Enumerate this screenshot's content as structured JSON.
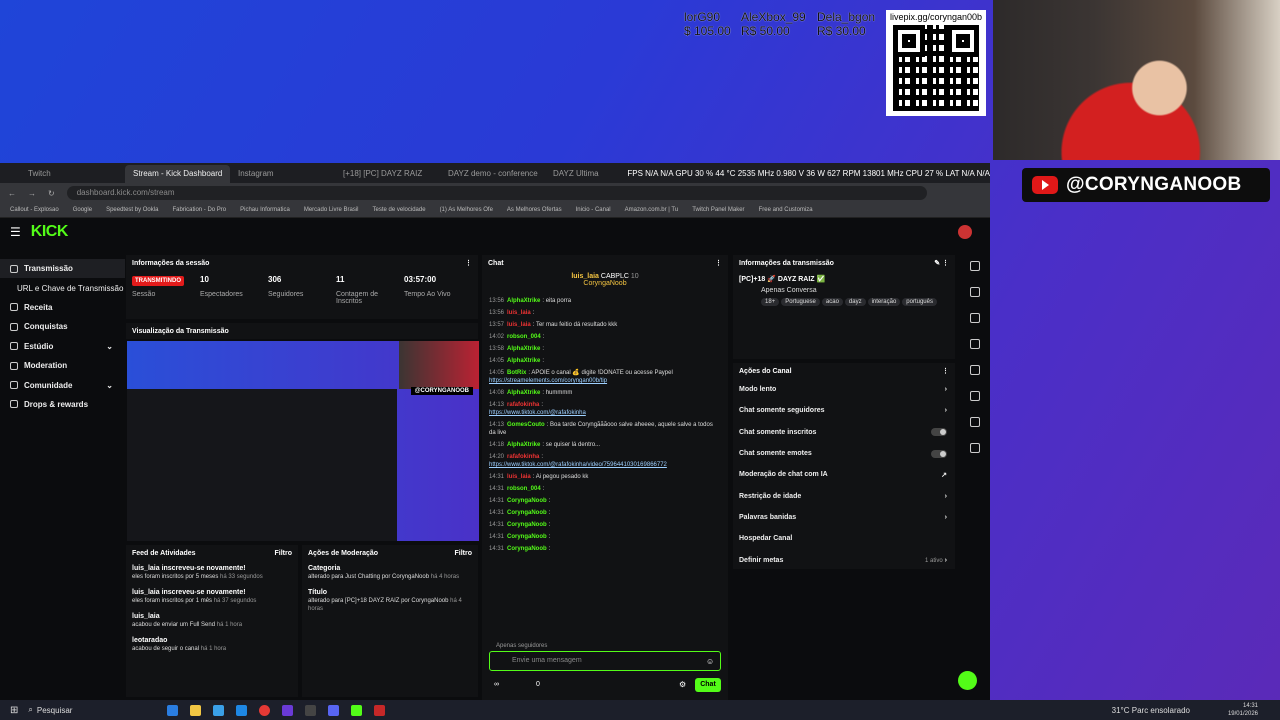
{
  "overlay": {
    "donors": [
      {
        "name": "lorG90",
        "amount": "$ 105.00"
      },
      {
        "name": "AleXbox_99",
        "amount": "R$ 50.00"
      },
      {
        "name": "Dela_bgon",
        "amount": "R$ 30.00"
      }
    ],
    "qr_url": "livepix.gg/coryngan00b",
    "handle": "@CORYNGANOOB"
  },
  "browser": {
    "tabs": [
      "Twitch",
      "Stream - Kick Dashboard",
      "Instagram",
      "[+18] [PC] DAYZ RAIZ",
      "DAYZ demo - conference",
      "DAYZ Ultima"
    ],
    "active_tab": 1,
    "url": "dashboard.kick.com/stream",
    "bookmarks": [
      "Callout - Explosao",
      "Google",
      "Speedtest by Ookla",
      "Fabrication - Do Pro",
      "Pichau Informatica",
      "Mercado Livre Brasil",
      "Teste de velocidade",
      "(1) As Melhores Ofe",
      "As Melhores Ofertas",
      "Inicio - Canal",
      "Amazon.com.br | Tu",
      "Twitch Panel Maker",
      "Free and Customiza"
    ],
    "stats": "FPS N/A  N/A   GPU 30 %  44 °C  2535 MHz  0.980 V  36 W  627 RPM  13801 MHz   CPU 27 %   LAT N/A  N/A"
  },
  "kick": {
    "logo": "KICK",
    "sidebar": [
      {
        "label": "Transmissão",
        "sub": false
      },
      {
        "label": "URL e Chave de Transmissão",
        "sub": true
      },
      {
        "label": "Receita",
        "sub": false
      },
      {
        "label": "Conquistas",
        "sub": false
      },
      {
        "label": "Estúdio",
        "sub": false
      },
      {
        "label": "Moderation",
        "sub": false
      },
      {
        "label": "Comunidade",
        "sub": false
      },
      {
        "label": "Drops & rewards",
        "sub": false
      }
    ],
    "session": {
      "title": "Informações da sessão",
      "status": "TRANSMITINDO",
      "status_label": "Sessão",
      "tiles": [
        {
          "value": "10",
          "label": "Espectadores"
        },
        {
          "value": "306",
          "label": "Seguidores"
        },
        {
          "value": "11",
          "label": "Contagem de Inscritos"
        },
        {
          "value": "03:57:00",
          "label": "Tempo Ao Vivo"
        }
      ]
    },
    "preview_title": "Visualização da Transmissão",
    "feed": {
      "title": "Feed de Atividades",
      "filter": "Filtro",
      "items": [
        {
          "user": "luis_laia inscreveu-se novamente!",
          "detail": "eles foram inscritos por 5 meses",
          "time": "há 33 segundos"
        },
        {
          "user": "luis_laia inscreveu-se novamente!",
          "detail": "eles foram inscritos por 1 mês",
          "time": "há 37 segundos"
        },
        {
          "user": "luis_laia",
          "detail": "acabou de enviar um Full Send",
          "time": "há 1 hora"
        },
        {
          "user": "leotaradao",
          "detail": "acabou de seguir o canal",
          "time": "há 1 hora"
        }
      ]
    },
    "moderation": {
      "title": "Ações de Moderação",
      "filter": "Filtro",
      "items": [
        {
          "title": "Categoria",
          "detail": "alterado para Just Chatting por CoryngaNoob",
          "time": "há 4 horas"
        },
        {
          "title": "Título",
          "detail": "alterado para [PC]+18 DAYZ RAIZ por CoryngaNoob",
          "time": "há 4 horas"
        }
      ]
    },
    "chat": {
      "title": "Chat",
      "pinned": {
        "user": "luis_laia",
        "badge": "CABPLC",
        "count": "10",
        "sub": "CoryngaNoob"
      },
      "messages": [
        {
          "time": "13:56",
          "user": "AlphaXtrike",
          "text": "eita porra"
        },
        {
          "time": "13:56",
          "user": "luis_laia",
          "text": "",
          "red": true
        },
        {
          "time": "13:57",
          "user": "luis_laia",
          "text": "Ter mau feitio dá resultado kkk",
          "red": true
        },
        {
          "time": "14:02",
          "user": "robson_004",
          "text": ""
        },
        {
          "time": "13:58",
          "user": "AlphaXtrike",
          "text": ""
        },
        {
          "time": "14:05",
          "user": "AlphaXtrike",
          "text": ""
        },
        {
          "time": "14:05",
          "user": "BotRix",
          "text": "APOIE o canal 💰 digite !DONATE ou acesse Paypel",
          "link": "https://streamelements.com/coryngan00b/tip"
        },
        {
          "time": "14:08",
          "user": "AlphaXtrike",
          "text": "hummmm"
        },
        {
          "time": "14:13",
          "user": "rafafokinha",
          "text": "",
          "red": true,
          "link": "https://www.tiktok.com/@rafafokinha"
        },
        {
          "time": "14:13",
          "user": "GomesCouto",
          "text": "Boa tarde Coryngãããooo salve aheeee, aquele salve a todos da live"
        },
        {
          "time": "14:18",
          "user": "AlphaXtrike",
          "text": "se quiser lá dentro..."
        },
        {
          "time": "14:20",
          "user": "rafafokinha",
          "text": "",
          "red": true,
          "link": "https://www.tiktok.com/@rafafokinha/video/7596441030169866772"
        },
        {
          "time": "14:31",
          "user": "luis_laia",
          "text": "Ai pegou pesado kk",
          "red": true
        },
        {
          "time": "14:31",
          "user": "robson_004",
          "text": ""
        },
        {
          "time": "14:31",
          "user": "CoryngaNoob",
          "text": ""
        },
        {
          "time": "14:31",
          "user": "CoryngaNoob",
          "text": ""
        },
        {
          "time": "14:31",
          "user": "CoryngaNoob",
          "text": ""
        },
        {
          "time": "14:31",
          "user": "CoryngaNoob",
          "text": ""
        },
        {
          "time": "14:31",
          "user": "CoryngaNoob",
          "text": ""
        }
      ],
      "followers_only": "Apenas seguidores",
      "placeholder": "Envie uma mensagem",
      "send": "Chat",
      "counter": "0"
    },
    "stream_info": {
      "title": "Informações da transmissão",
      "stream_title": "[PC]+18 🚀 DAYZ RAIZ ✅",
      "category": "Apenas Conversa",
      "tags": [
        "18+",
        "Portuguese",
        "acao",
        "dayz",
        "interação",
        "português"
      ]
    },
    "channel_actions": {
      "title": "Ações do Canal",
      "items": [
        {
          "label": "Modo lento",
          "control": "chevron"
        },
        {
          "label": "Chat somente seguidores",
          "control": "chevron"
        },
        {
          "label": "Chat somente inscritos",
          "control": "toggle"
        },
        {
          "label": "Chat somente emotes",
          "control": "toggle"
        },
        {
          "label": "Moderação de chat com IA",
          "control": "external"
        },
        {
          "label": "Restrição de idade",
          "control": "chevron"
        },
        {
          "label": "Palavras banidas",
          "control": "chevron"
        },
        {
          "label": "Hospedar Canal",
          "control": "none"
        },
        {
          "label": "Definir metas",
          "control": "chevron",
          "extra": "1 ativo"
        }
      ]
    }
  },
  "taskbar": {
    "search": "Pesquisar",
    "weather": "31°C  Parc ensolarado",
    "time": "14:31",
    "date": "19/01/2026"
  }
}
